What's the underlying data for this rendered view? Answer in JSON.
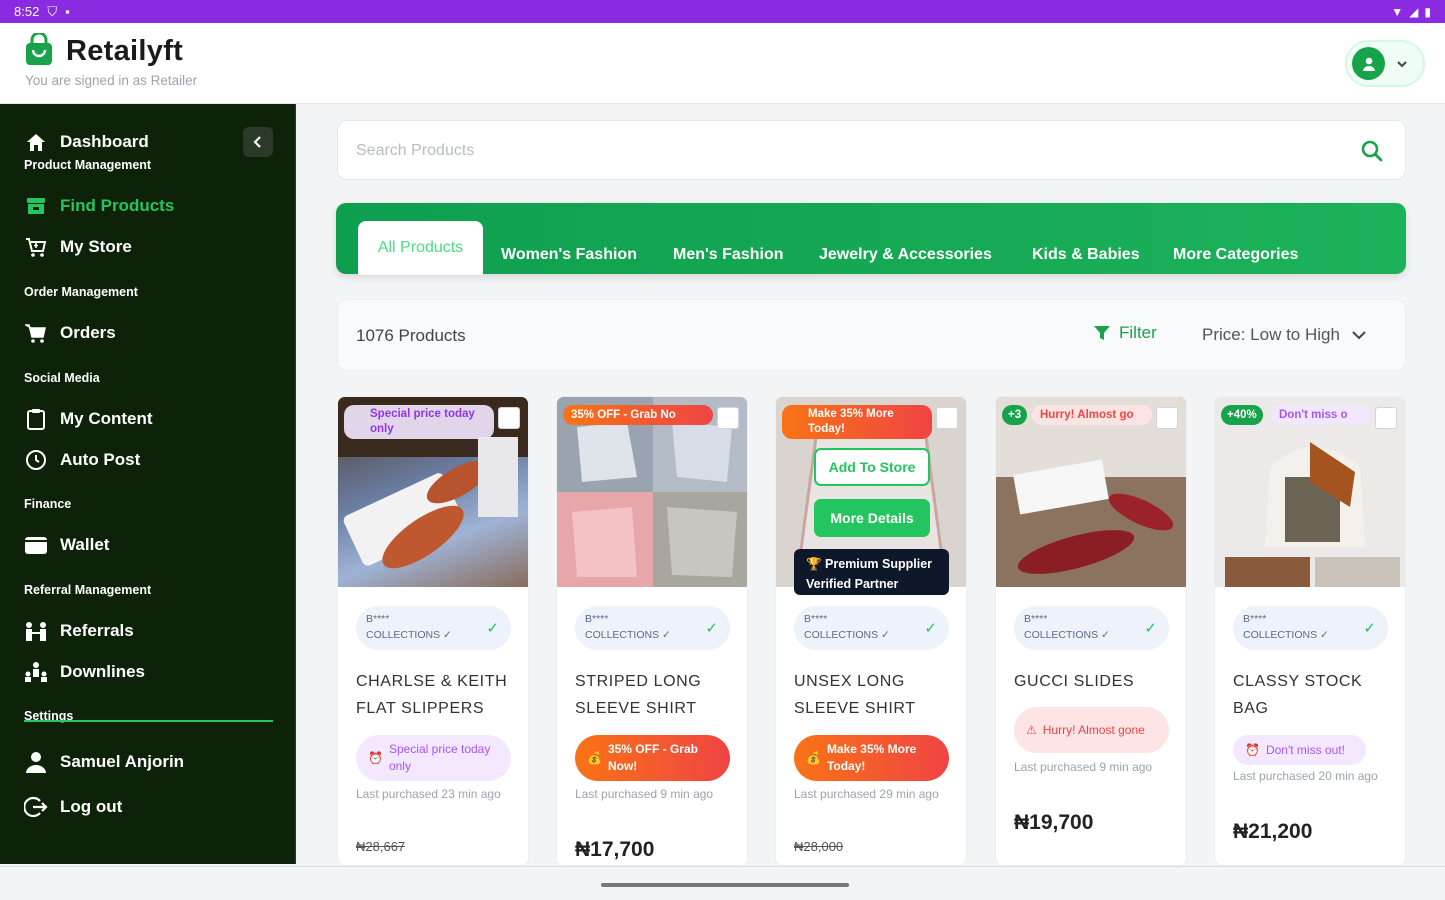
{
  "status_bar": {
    "time": "8:52"
  },
  "header": {
    "app_name": "Retailyft",
    "signed_in_text": "You are signed in as Retailer"
  },
  "sidebar": {
    "items": [
      {
        "label": "Dashboard",
        "icon": "home-icon"
      },
      {
        "label": "Find Products",
        "icon": "store-icon"
      },
      {
        "label": "My Store",
        "icon": "cart-icon"
      },
      {
        "label": "Orders",
        "icon": "cart-icon"
      },
      {
        "label": "My Content",
        "icon": "clipboard-icon"
      },
      {
        "label": "Auto Post",
        "icon": "clock-icon"
      },
      {
        "label": "Wallet",
        "icon": "wallet-icon"
      },
      {
        "label": "Referrals",
        "icon": "referrals-icon"
      },
      {
        "label": "Downlines",
        "icon": "downlines-icon"
      },
      {
        "label": "Samuel Anjorin",
        "icon": "user-icon"
      },
      {
        "label": "Log out",
        "icon": "logout-icon"
      }
    ],
    "sections": {
      "product_management": "Product Management",
      "order_management": "Order Management",
      "social_media": "Social Media",
      "finance": "Finance",
      "referral_management": "Referral Management",
      "settings": "Settings"
    },
    "active_item": "Find Products"
  },
  "search": {
    "placeholder": "Search Products",
    "value": ""
  },
  "categories": {
    "tabs": [
      "All Products",
      "Women's Fashion",
      "Men's Fashion",
      "Jewelry & Accessories",
      "Kids & Babies",
      "More Categories"
    ],
    "active": "All Products"
  },
  "filter_bar": {
    "count": "1076 Products",
    "filter_label": "Filter",
    "sort_label": "Price: Low to High"
  },
  "products": [
    {
      "promo": "Special price today only",
      "supplier": "B****",
      "supplier_line2": "COLLECTIONS ✓",
      "title": "CHARLSE & KEITH FLAT SLIPPERS",
      "urgency": "Special price today only",
      "last_purchased": "Last purchased 23 min ago",
      "price": "₦28,667"
    },
    {
      "promo": "35% OFF - Grab No",
      "supplier": "B****",
      "supplier_line2": "COLLECTIONS ✓",
      "title": "STRIPED LONG SLEEVE SHIRT",
      "urgency": "35% OFF - Grab Now!",
      "last_purchased": "Last purchased 9 min ago",
      "price": "₦17,700"
    },
    {
      "promo": "Make 35% More Today!",
      "supplier": "B****",
      "supplier_line2": "COLLECTIONS ✓",
      "title": "UNSEX LONG SLEEVE SHIRT",
      "urgency": "Make 35% More Today!",
      "last_purchased": "Last purchased 29 min ago",
      "price": "₦28,000",
      "add_to_store": "Add To Store",
      "more_details": "More Details",
      "tooltip": "🏆 Premium Supplier Verified Partner"
    },
    {
      "badge": "+3",
      "promo": "Hurry! Almost go",
      "supplier": "B****",
      "supplier_line2": "COLLECTIONS ✓",
      "title": "GUCCI SLIDES",
      "urgency": "Hurry! Almost gone",
      "last_purchased": "Last purchased 9 min ago",
      "price": "₦19,700"
    },
    {
      "badge": "+40%",
      "promo": "Don't miss o",
      "supplier": "B****",
      "supplier_line2": "COLLECTIONS ✓",
      "title": "CLASSY STOCK BAG",
      "urgency": "Don't miss out!",
      "last_purchased": "Last purchased 20 min ago",
      "price": "₦21,200"
    }
  ],
  "colors": {
    "brand_green": "#16a34a",
    "sidebar_bg": "#0d2208",
    "status_bar": "#8a2be2"
  }
}
